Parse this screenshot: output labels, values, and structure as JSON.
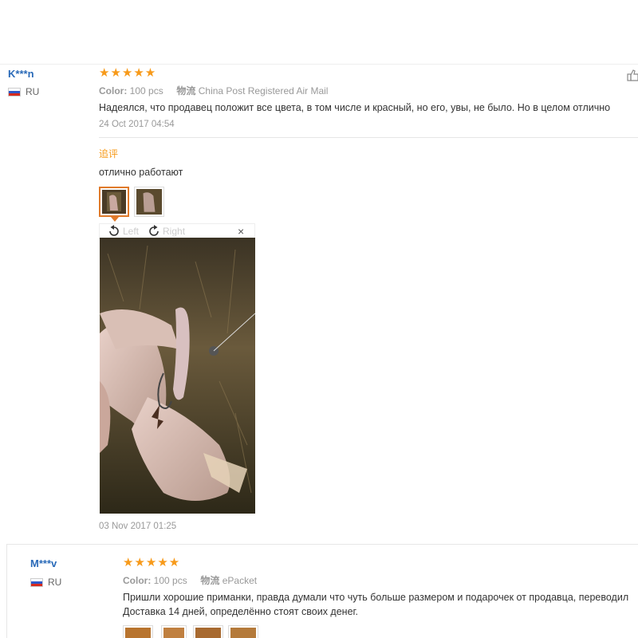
{
  "review1": {
    "user": "K***n",
    "country": "RU",
    "stars": "★★★★★",
    "color_label": "Color:",
    "color_value": "100 pcs",
    "shipping_label": "物流",
    "shipping_value": "China Post Registered Air Mail",
    "text": "Надеялся, что продавец положит все цвета, в том числе и красный, но его, увы, не было. Но в целом отлично",
    "date": "24 Oct 2017 04:54",
    "followup": {
      "label": "追评",
      "text": "отлично работают",
      "date": "03 Nov 2017 01:25"
    },
    "viewer": {
      "left_label": "Left",
      "right_label": "Right",
      "close_label": "×"
    }
  },
  "review2": {
    "user": "M***v",
    "country": "RU",
    "stars": "★★★★★",
    "color_label": "Color:",
    "color_value": "100 pcs",
    "shipping_label": "物流",
    "shipping_value": "ePacket",
    "text_line1": "Пришли хорошие приманки, правда думали что чуть больше размером и подарочек от продавца, переводил",
    "text_line2": "Доставка 14 дней, определённо стоят своих денег."
  },
  "colors": {
    "accent": "#f79a1a",
    "username": "#2a6ab8",
    "active_thumb": "#e07a2a"
  }
}
